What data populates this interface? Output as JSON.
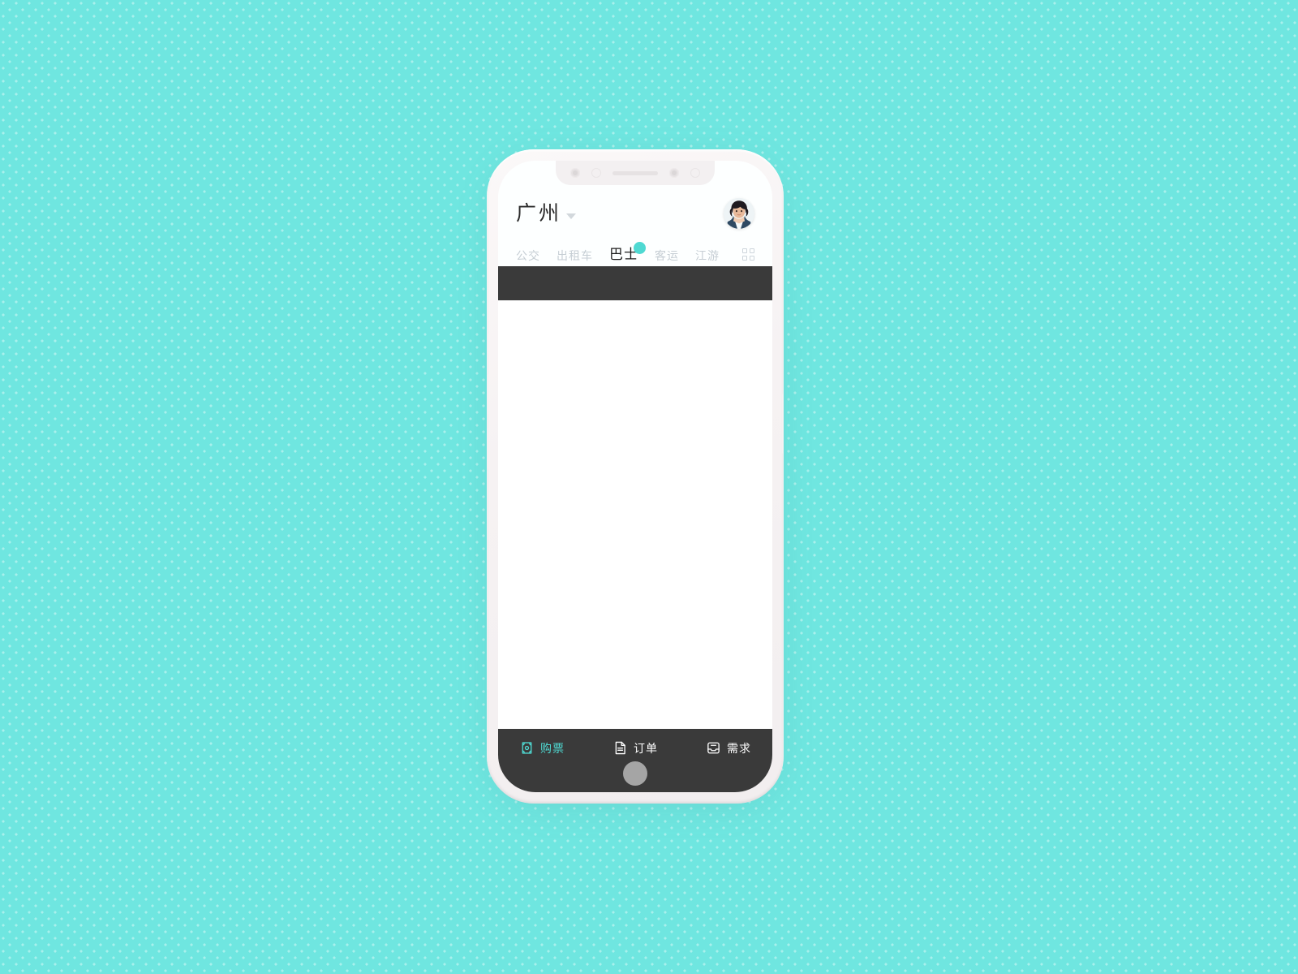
{
  "theme": {
    "background_color": "#6fe6e0",
    "accent_color": "#4fd9d2",
    "dark_bar_color": "#3a3a3a",
    "screen_color": "#ffffff",
    "muted_text_color": "#c6ced4"
  },
  "device": {
    "frame_label": "smartphone-mockup",
    "notch": {
      "camera_icon": "camera-icon",
      "sensor_icon": "sensor-icon",
      "speaker_icon": "speaker-grill-icon"
    },
    "buttons": {
      "silent_switch": "silent-switch",
      "volume_up": "volume-up-button",
      "volume_down": "volume-down-button",
      "power": "power-button"
    },
    "home_indicator": "home-button"
  },
  "header": {
    "city": "广州",
    "city_dropdown_icon": "chevron-down-icon",
    "avatar_icon": "user-avatar"
  },
  "tabs": {
    "items": [
      {
        "label": "公交",
        "active": false,
        "badge": false
      },
      {
        "label": "出租车",
        "active": false,
        "badge": false
      },
      {
        "label": "巴士",
        "active": true,
        "badge": true
      },
      {
        "label": "客运",
        "active": false,
        "badge": false
      },
      {
        "label": "江游",
        "active": false,
        "badge": false
      }
    ],
    "more_icon": "grid-menu-icon"
  },
  "banner": {
    "label": "",
    "color": "#3a3a3a"
  },
  "content": {
    "body_text": ""
  },
  "bottom_nav": {
    "items": [
      {
        "label": "购票",
        "icon": "ticket-icon",
        "active": true
      },
      {
        "label": "订单",
        "icon": "document-icon",
        "active": false
      },
      {
        "label": "需求",
        "icon": "inbox-icon",
        "active": false
      }
    ]
  }
}
